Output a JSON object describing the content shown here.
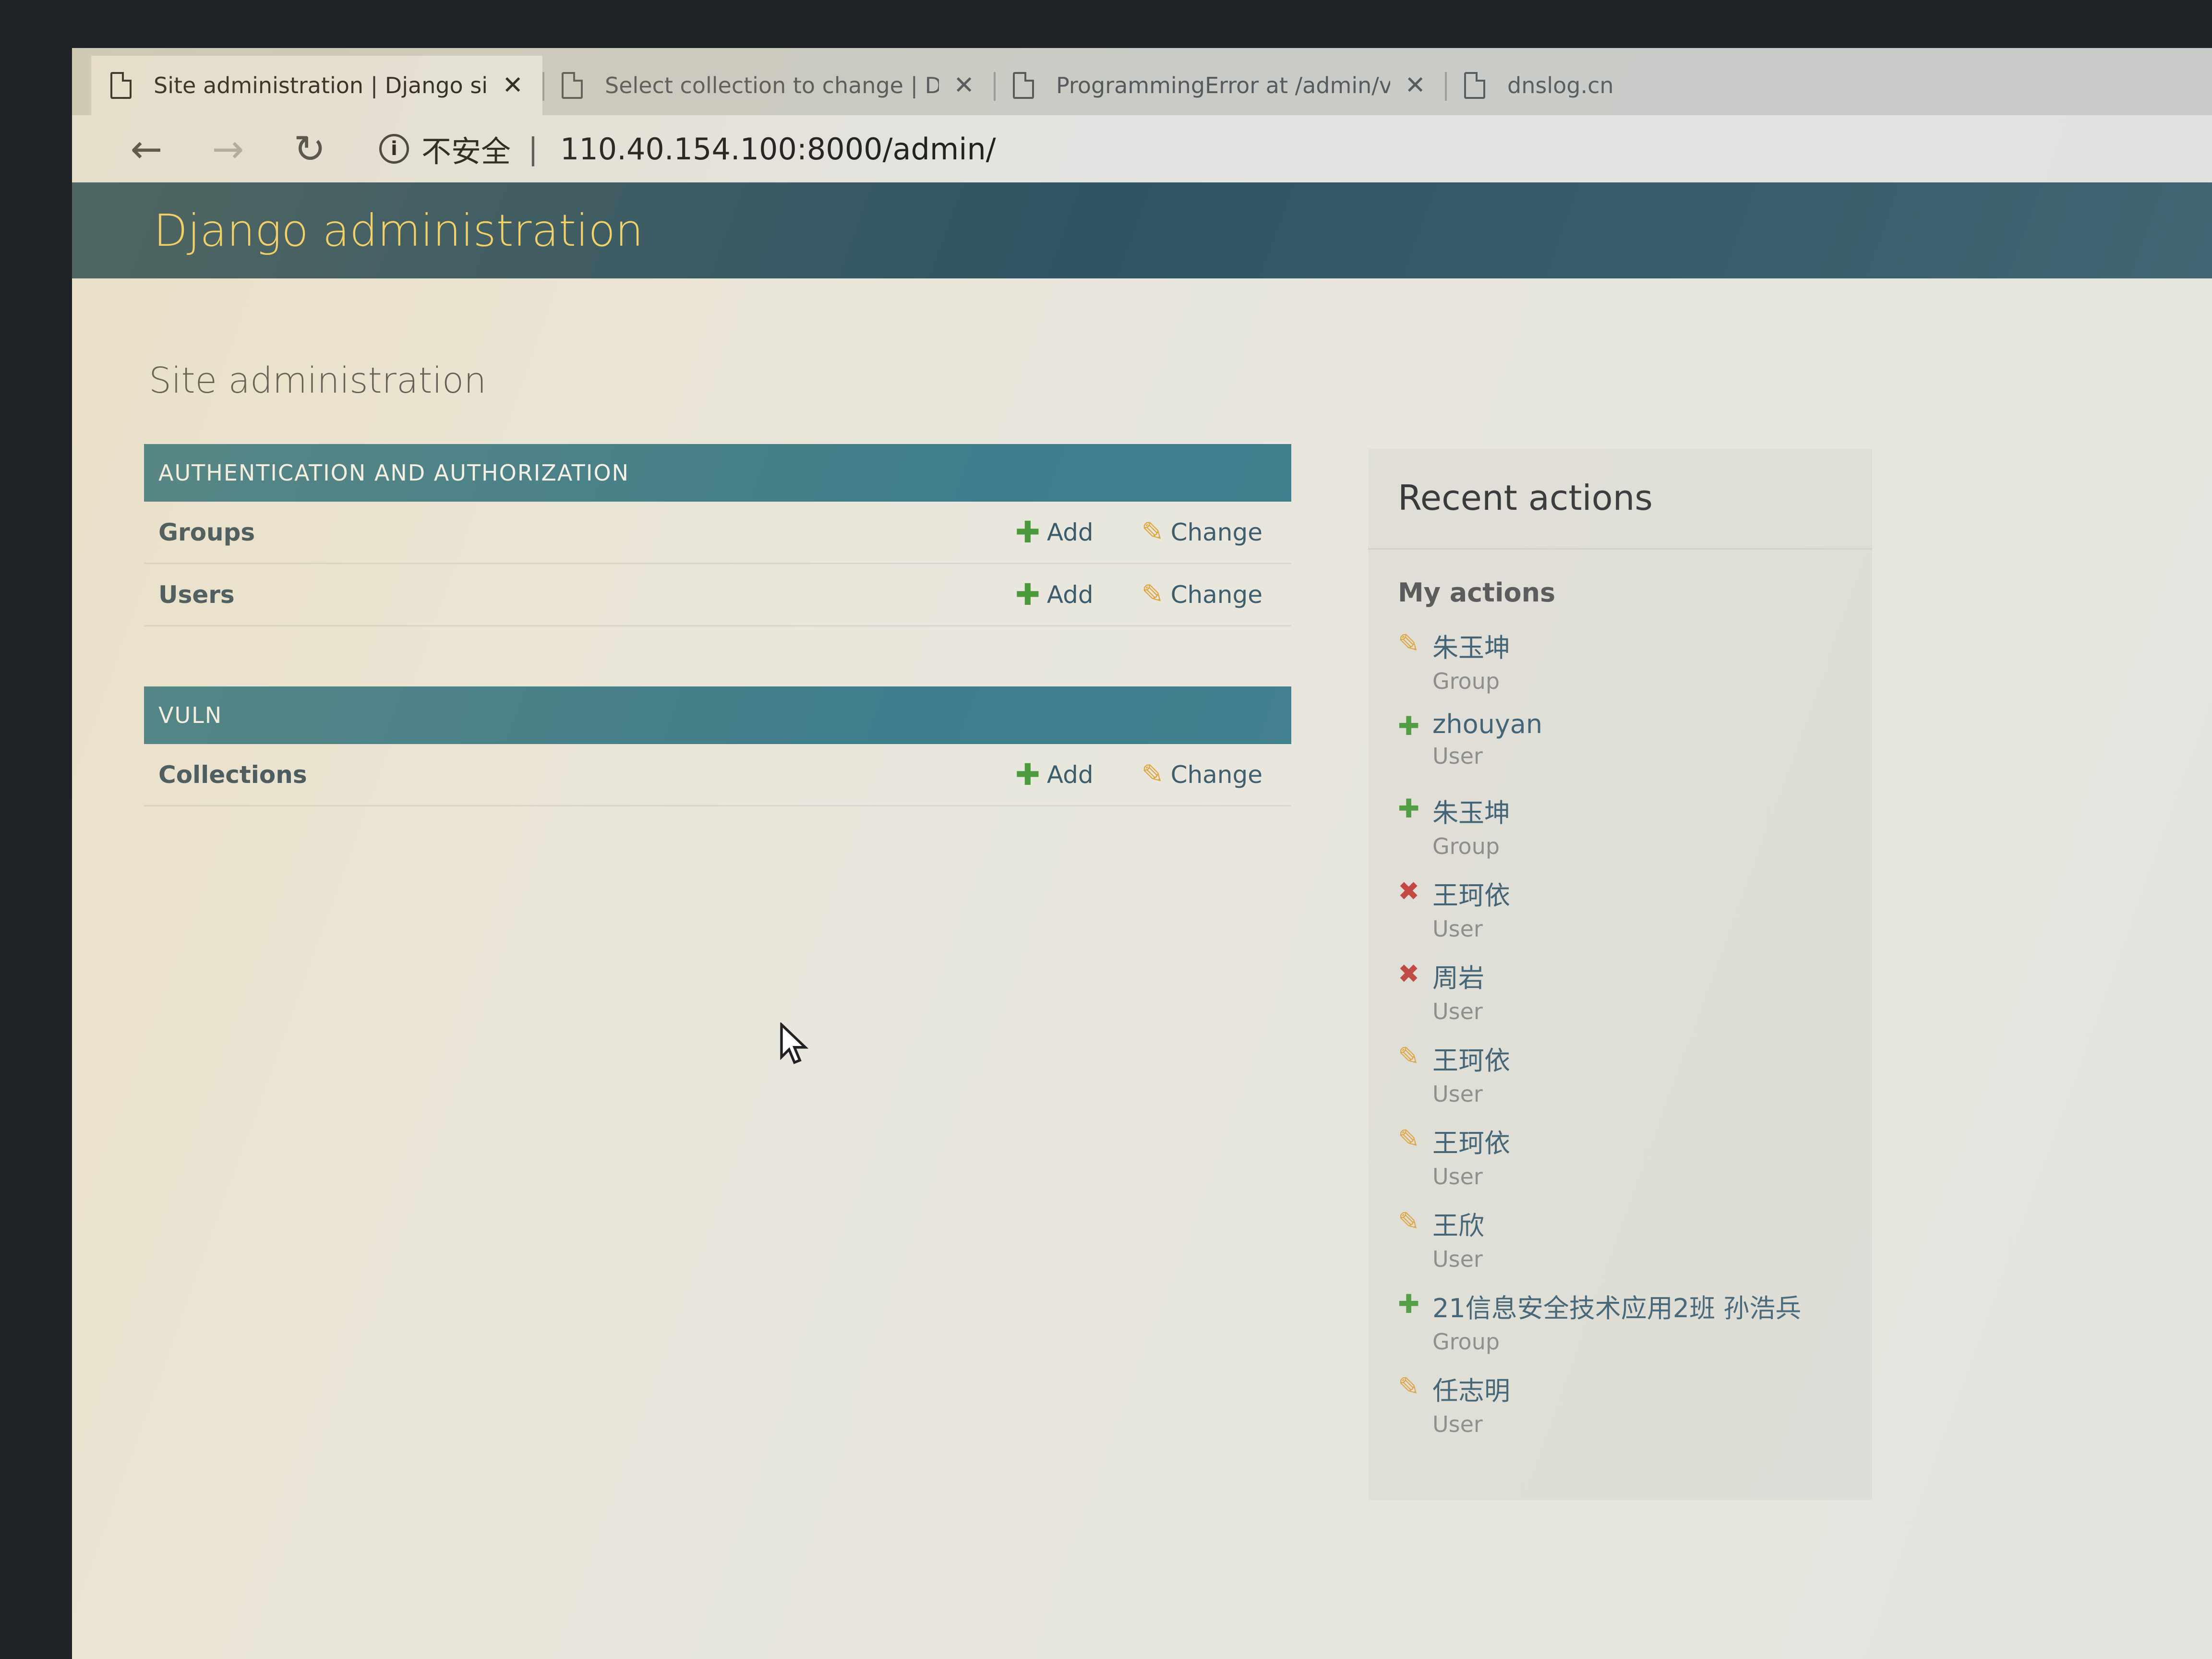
{
  "browser": {
    "tabs": [
      {
        "title": "Site administration | Django site",
        "active": true
      },
      {
        "title": "Select collection to change | Dja",
        "active": false
      },
      {
        "title": "ProgrammingError at /admin/vu",
        "active": false
      },
      {
        "title": "dnslog.cn",
        "active": false
      }
    ],
    "close_glyph": "✕",
    "nav": {
      "back": "←",
      "forward": "→",
      "reload": "↻"
    },
    "security_label": "不安全",
    "url_separator": "|",
    "url": "110.40.154.100:8000/admin/"
  },
  "header": {
    "brand": "Django administration"
  },
  "main": {
    "title": "Site administration",
    "modules": [
      {
        "caption": "AUTHENTICATION AND AUTHORIZATION",
        "models": [
          {
            "name": "Groups",
            "add": "Add",
            "change": "Change"
          },
          {
            "name": "Users",
            "add": "Add",
            "change": "Change"
          }
        ]
      },
      {
        "caption": "VULN",
        "models": [
          {
            "name": "Collections",
            "add": "Add",
            "change": "Change"
          }
        ]
      }
    ]
  },
  "recent_actions": {
    "title": "Recent actions",
    "subtitle": "My actions",
    "items": [
      {
        "name": "朱玉坤",
        "type": "Group",
        "action": "changed",
        "icon": "pencil-icon"
      },
      {
        "name": "zhouyan",
        "type": "User",
        "action": "added",
        "icon": "plus-icon"
      },
      {
        "name": "朱玉坤",
        "type": "Group",
        "action": "added",
        "icon": "plus-icon"
      },
      {
        "name": "王珂依",
        "type": "User",
        "action": "deleted",
        "icon": "delete-icon"
      },
      {
        "name": "周岩",
        "type": "User",
        "action": "deleted",
        "icon": "delete-icon"
      },
      {
        "name": "王珂依",
        "type": "User",
        "action": "changed",
        "icon": "pencil-icon"
      },
      {
        "name": "王珂依",
        "type": "User",
        "action": "changed",
        "icon": "pencil-icon"
      },
      {
        "name": "王欣",
        "type": "User",
        "action": "changed",
        "icon": "pencil-icon"
      },
      {
        "name": "21信息安全技术应用2班 孙浩兵",
        "type": "Group",
        "action": "added",
        "icon": "plus-icon"
      },
      {
        "name": "任志明",
        "type": "User",
        "action": "changed",
        "icon": "pencil-icon"
      }
    ]
  },
  "icons": {
    "add": "✚",
    "change": "✎",
    "added": "✚",
    "changed": "✎",
    "deleted": "✖"
  },
  "colors": {
    "header_bg": "#2f5464",
    "brand": "#f3d36a",
    "module_caption_bg": "#3e7d8c",
    "add_green": "#4a9a3a",
    "change_yellow": "#e0a43a",
    "delete_red": "#c2403a"
  }
}
